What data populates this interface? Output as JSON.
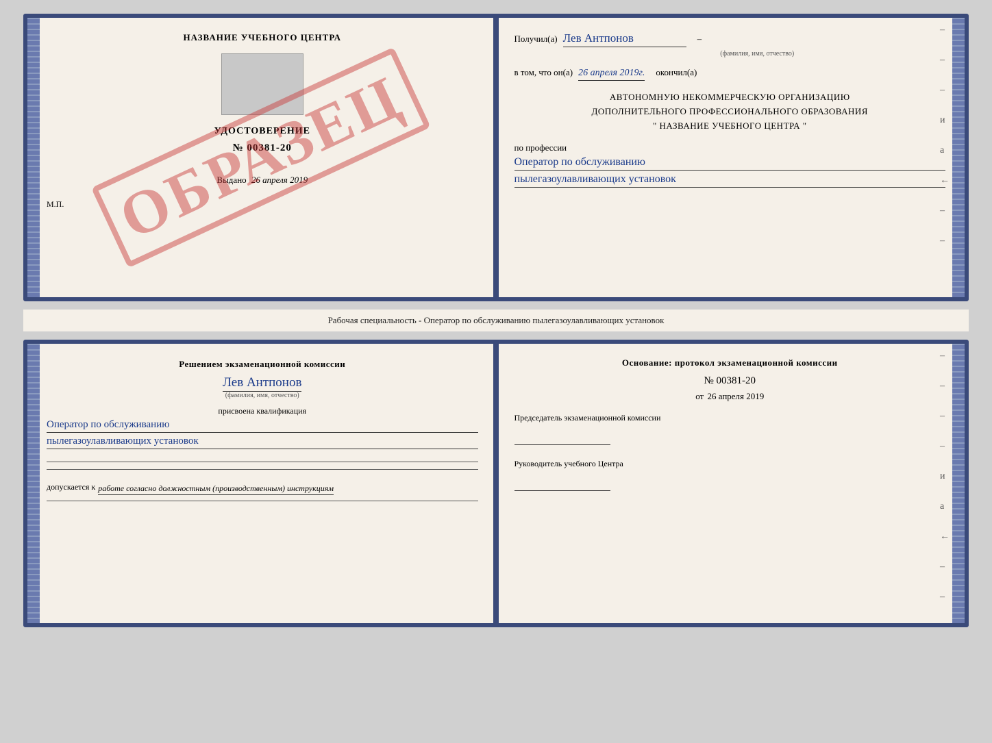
{
  "top_book": {
    "left_page": {
      "title": "НАЗВАНИЕ УЧЕБНОГО ЦЕНТРА",
      "cert_label": "УДОСТОВЕРЕНИЕ",
      "cert_number": "№ 00381-20",
      "issued_label": "Выдано",
      "issued_date": "26 апреля 2019",
      "mp_label": "М.П.",
      "watermark": "ОБРАЗЕЦ"
    },
    "right_page": {
      "received_label": "Получил(а)",
      "received_name": "Лев Антпонов",
      "fio_label": "(фамилия, имя, отчество)",
      "in_that_label": "в том, что он(а)",
      "in_that_date": "26 апреля 2019г.",
      "finished_label": "окончил(а)",
      "org_line1": "АВТОНОМНУЮ НЕКОММЕРЧЕСКУЮ ОРГАНИЗАЦИЮ",
      "org_line2": "ДОПОЛНИТЕЛЬНОГО ПРОФЕССИОНАЛЬНОГО ОБРАЗОВАНИЯ",
      "org_line3": "\"   НАЗВАНИЕ УЧЕБНОГО ЦЕНТРА   \"",
      "profession_label": "по профессии",
      "profession_line1": "Оператор по обслуживанию",
      "profession_line2": "пылегазоулавливающих установок"
    }
  },
  "middle_label": "Рабочая специальность - Оператор по обслуживанию пылегазоулавливающих установок",
  "bottom_book": {
    "left_page": {
      "decision_title": "Решением экзаменационной комиссии",
      "person_name": "Лев Антпонов",
      "fio_label": "(фамилия, имя, отчество)",
      "assigned_label": "присвоена квалификация",
      "qual_line1": "Оператор по обслуживанию",
      "qual_line2": "пылегазоулавливающих установок",
      "admitted_label": "допускается к",
      "admitted_text": "работе согласно должностным (производственным) инструкциям"
    },
    "right_page": {
      "basis_label": "Основание: протокол экзаменационной комиссии",
      "protocol_number": "№ 00381-20",
      "from_prefix": "от",
      "from_date": "26 апреля 2019",
      "chairman_label": "Председатель экзаменационной комиссии",
      "center_leader_label": "Руководитель учебного Центра"
    }
  },
  "dashes": [
    "-",
    "-",
    "-",
    "–",
    "и",
    "а",
    "←",
    "-",
    "-"
  ]
}
